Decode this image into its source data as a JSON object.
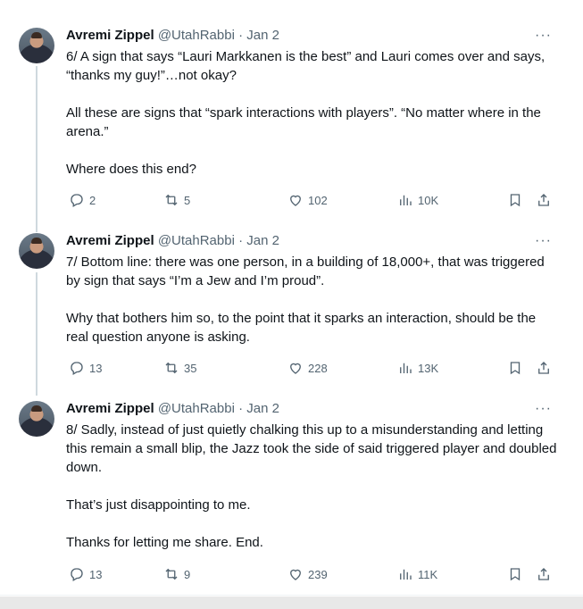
{
  "tweets": [
    {
      "author": "Avremi Zippel",
      "handle": "@UtahRabbi",
      "date": "· Jan 2",
      "paragraphs": [
        "6/ A sign that says “Lauri Markkanen is the best” and Lauri comes over and says, “thanks my guy!”…not okay?",
        "All these are signs that “spark interactions with players”. “No matter where in the arena.”",
        "Where does this end?"
      ],
      "replies": "2",
      "reposts": "5",
      "likes": "102",
      "views": "10K"
    },
    {
      "author": "Avremi Zippel",
      "handle": "@UtahRabbi",
      "date": "· Jan 2",
      "paragraphs": [
        "7/ Bottom line: there was one person, in a building of 18,000+, that was triggered by sign that says “I’m a Jew and I’m proud”.",
        "Why that bothers him so, to the point that it sparks an interaction, should be the real question anyone is asking."
      ],
      "replies": "13",
      "reposts": "35",
      "likes": "228",
      "views": "13K"
    },
    {
      "author": "Avremi Zippel",
      "handle": "@UtahRabbi",
      "date": "· Jan 2",
      "paragraphs": [
        "8/ Sadly, instead of just quietly chalking this up to a misunderstanding and letting this remain a small blip, the Jazz took the side of said triggered player and doubled down.",
        "That’s just disappointing to me.",
        "Thanks for letting me share. End."
      ],
      "replies": "13",
      "reposts": "9",
      "likes": "239",
      "views": "11K"
    }
  ],
  "icons": [
    "more-icon",
    "reply-icon",
    "repost-icon",
    "like-icon",
    "views-icon",
    "bookmark-icon",
    "share-icon"
  ],
  "colors": {
    "text": "#0f1419",
    "muted": "#536471",
    "thread_line": "#cfd9de"
  }
}
